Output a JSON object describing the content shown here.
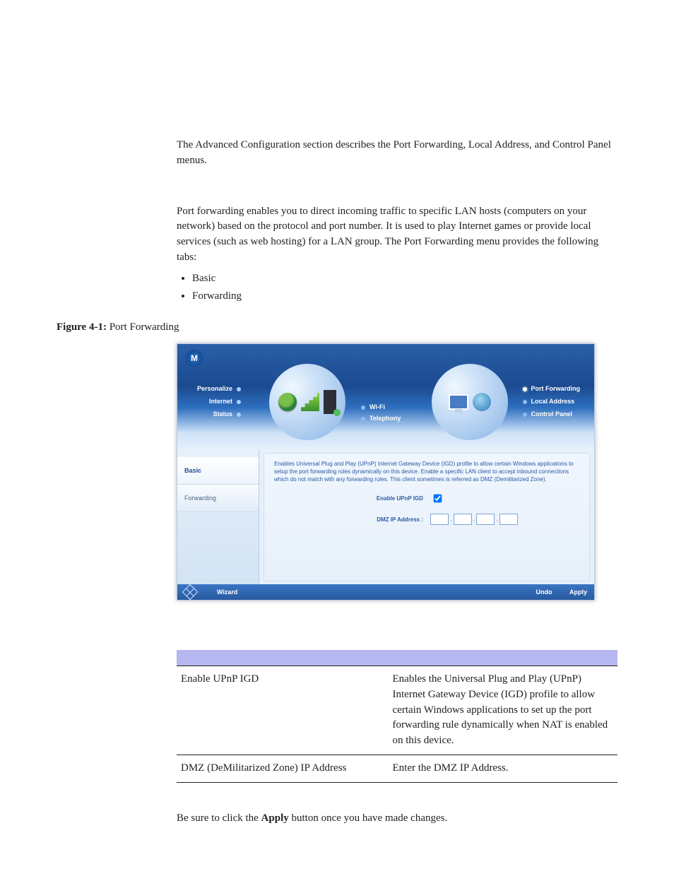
{
  "intro": "The Advanced Configuration section describes the Port Forwarding, Local Address, and Control Panel menus.",
  "pf_intro": "Port forwarding enables you to direct incoming traffic to specific LAN hosts (computers on your network) based on the protocol and port number. It is used to play Internet games or provide local services (such as web hosting) for a LAN group. The Port Forwarding menu provides the following tabs:",
  "bullets": [
    "Basic",
    "Forwarding"
  ],
  "figure": {
    "label": "Figure 4-1:",
    "title": "Port Forwarding"
  },
  "ui": {
    "logo_glyph": "M",
    "left_nav": [
      "Personalize",
      "Internet",
      "Status"
    ],
    "mid_nav": [
      "Wi-Fi",
      "Telephony"
    ],
    "right_nav": [
      {
        "label": "Port Forwarding",
        "active": true
      },
      {
        "label": "Local Address",
        "active": false
      },
      {
        "label": "Control Panel",
        "active": false
      }
    ],
    "side_tabs": [
      {
        "label": "Basic",
        "active": true
      },
      {
        "label": "Forwarding",
        "active": false
      }
    ],
    "desc": "Enables Universal Plug and Play (UPnP) Internet Gateway Device (IGD) profile to allow certain Windows applications to setup the port forwarding rules dynamically on this device. Enable a specific LAN client to accept inbound connections which do not match with any forwarding rules. This client sometimes is referred as DMZ (Demilitarized Zone).",
    "fields": {
      "enable_upnp_label": "Enable UPnP IGD",
      "enable_upnp_checked": true,
      "dmz_label": "DMZ IP Address :",
      "dmz_parts": [
        "",
        "",
        "",
        ""
      ]
    },
    "footer": {
      "wizard": "Wizard",
      "undo": "Undo",
      "apply": "Apply"
    }
  },
  "table": {
    "rows": [
      {
        "option": "Enable UPnP IGD",
        "description": "Enables the Universal Plug and Play (UPnP) Internet Gateway Device (IGD) profile to allow certain Windows applications to set up the port forwarding rule dynamically when NAT is enabled on this device."
      },
      {
        "option": "DMZ (DeMilitarized Zone) IP Address",
        "description": "Enter the DMZ IP Address."
      }
    ]
  },
  "closing": {
    "pre": "Be sure to click the ",
    "bold": "Apply",
    "post": " button once you have made changes."
  }
}
